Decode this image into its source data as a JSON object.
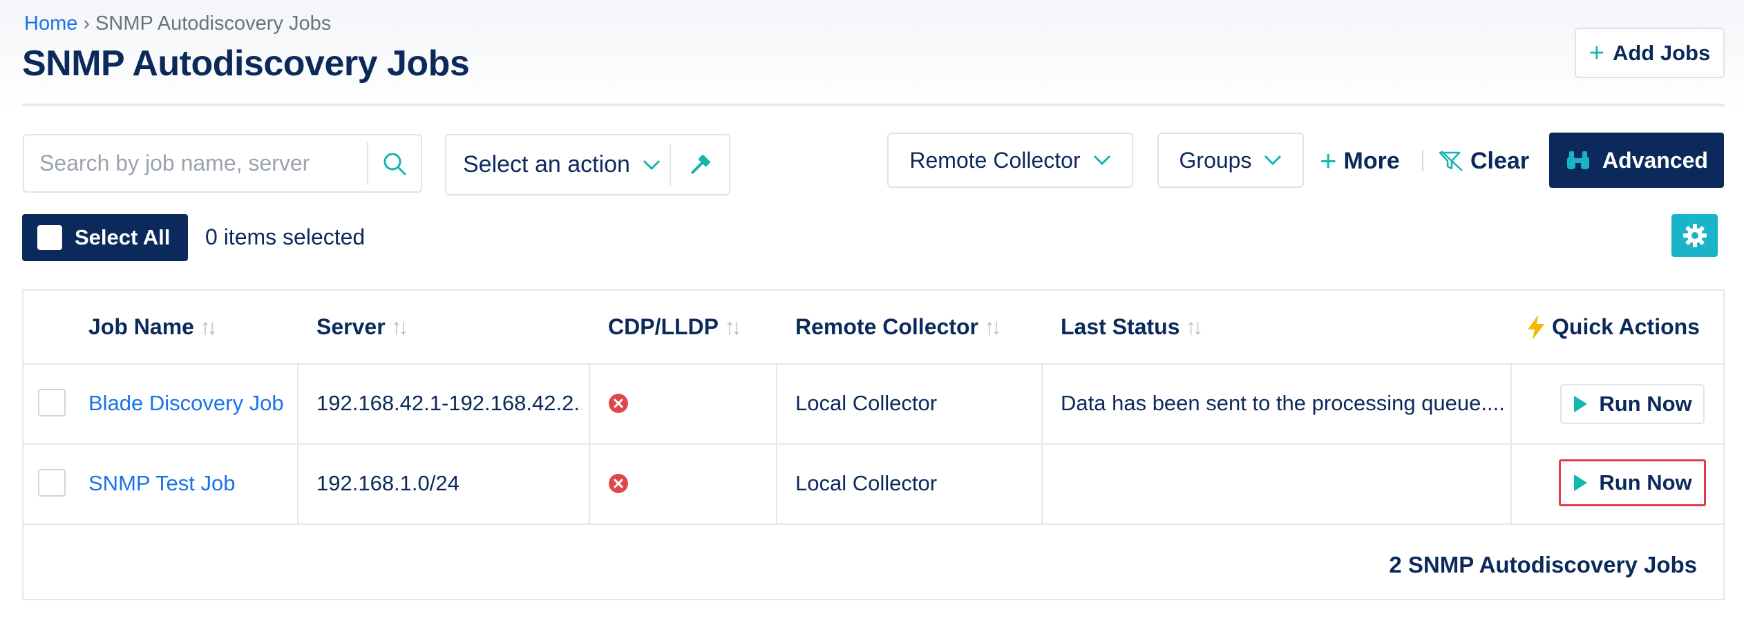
{
  "breadcrumb": {
    "home": "Home",
    "separator": "›",
    "current": "SNMP Autodiscovery Jobs"
  },
  "page": {
    "title": "SNMP Autodiscovery Jobs"
  },
  "toolbar": {
    "add_jobs": "Add Jobs",
    "search_placeholder": "Search by job name, server",
    "action_select": "Select an action",
    "remote_collector": "Remote Collector",
    "groups": "Groups",
    "more": "More",
    "clear": "Clear",
    "advanced": "Advanced"
  },
  "selection": {
    "select_all": "Select All",
    "items_selected": "0 items selected"
  },
  "table": {
    "columns": {
      "job_name": "Job Name",
      "server": "Server",
      "cdp_lldp": "CDP/LLDP",
      "remote_collector": "Remote Collector",
      "last_status": "Last Status",
      "quick_actions": "Quick Actions"
    },
    "rows": [
      {
        "job_name": "Blade Discovery Job",
        "server": "192.168.42.1-192.168.42.2...",
        "cdp_lldp": "disabled",
        "remote_collector": "Local Collector",
        "last_status": "Data has been sent to the processing queue....",
        "action": "Run Now"
      },
      {
        "job_name": "SNMP Test Job",
        "server": "192.168.1.0/24",
        "cdp_lldp": "disabled",
        "remote_collector": "Local Collector",
        "last_status": "",
        "action": "Run Now"
      }
    ],
    "footer": "2 SNMP Autodiscovery Jobs"
  },
  "colors": {
    "navy": "#0b2a5b",
    "link": "#1a73e8",
    "teal": "#13b5b1",
    "gear_bg": "#1ab3c7",
    "error_red": "#e0474c",
    "bolt_yellow": "#f5b800",
    "focus_outline": "#e63946"
  },
  "icons": {
    "add": "plus-icon",
    "search": "search-icon",
    "dropdown": "chevron-down-icon",
    "action": "gavel-icon",
    "clear": "clear-filter-icon",
    "advanced": "binoculars-icon",
    "settings": "gear-icon",
    "quick_actions": "lightning-icon",
    "cdp_status": "error-circle-icon",
    "run": "play-icon"
  }
}
